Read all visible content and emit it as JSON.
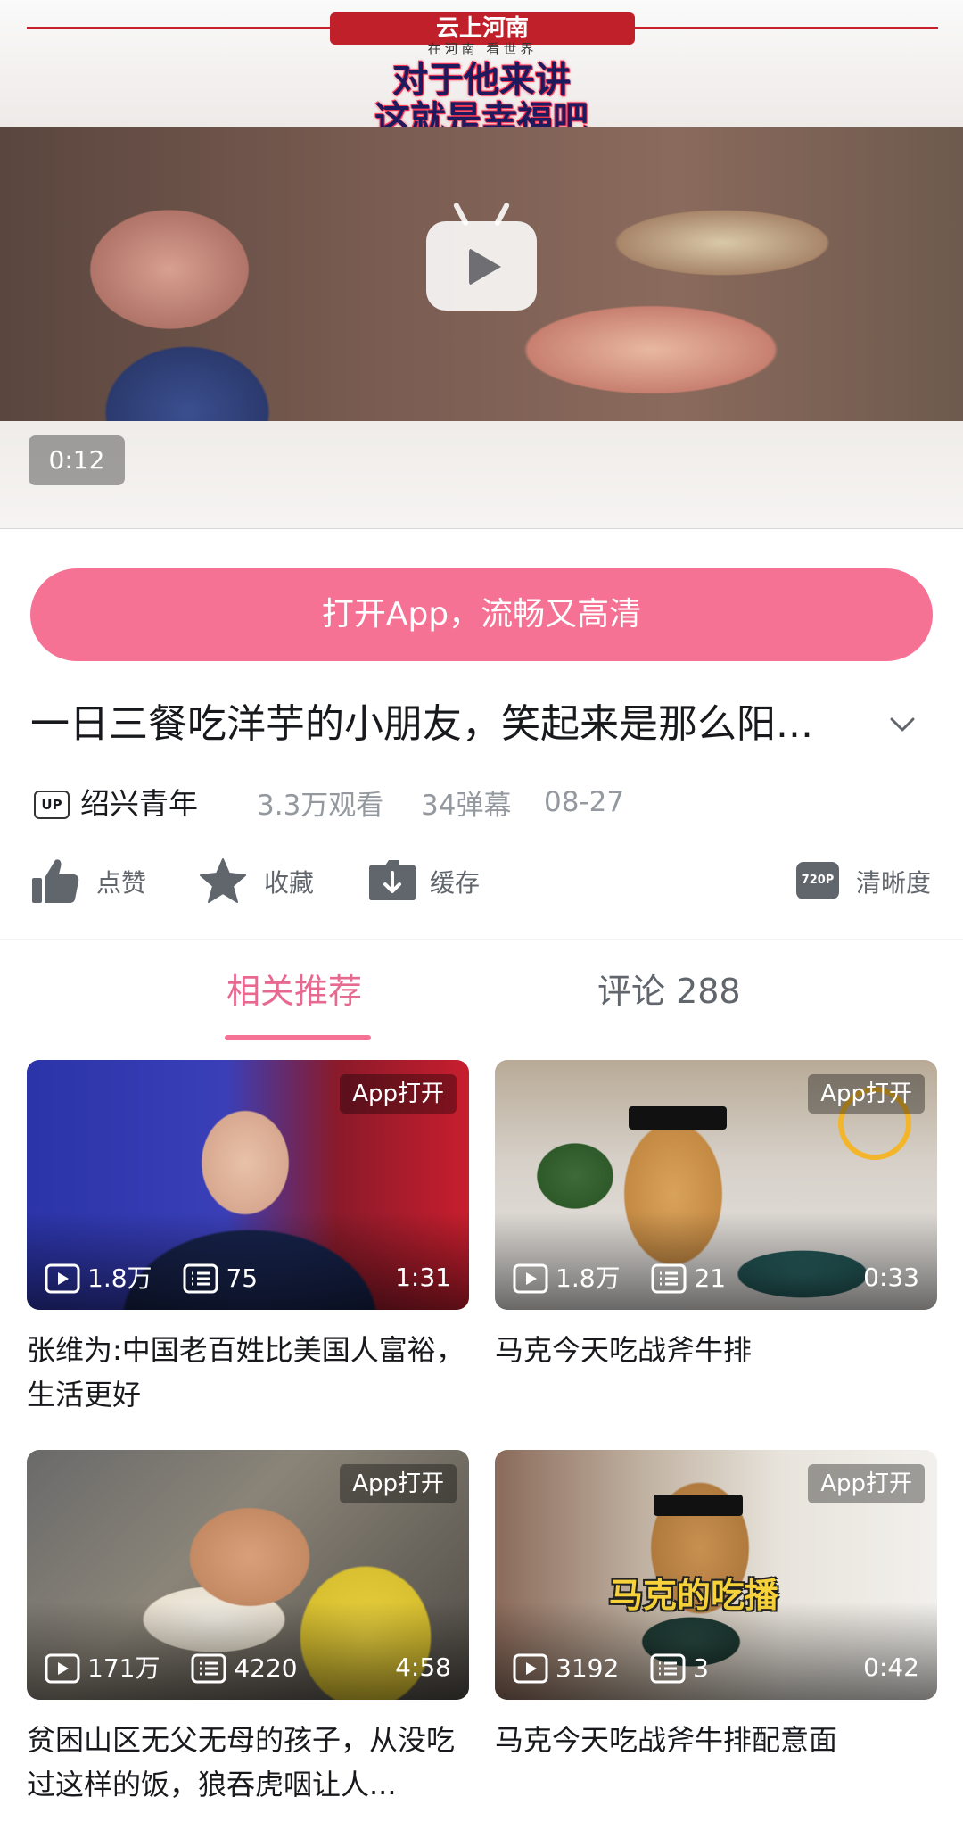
{
  "player": {
    "brand_name": "云上河南",
    "brand_tagline": "在河南  看世界",
    "headline_line1": "对于他来讲",
    "headline_line2": "这就是幸福吧",
    "duration": "0:12"
  },
  "open_app_button": "打开App，流畅又高清",
  "video": {
    "title": "一日三餐吃洋芋的小朋友，笑起来是那么阳...",
    "up_badge": "UP",
    "author": "绍兴青年",
    "views": "3.3万观看",
    "danmaku": "34弹幕",
    "date": "08-27"
  },
  "actions": {
    "like": "点赞",
    "favorite": "收藏",
    "cache": "缓存",
    "quality_badge": "720P",
    "quality": "清晰度"
  },
  "tabs": {
    "related": "相关推荐",
    "comments": "评论 288"
  },
  "cards": [
    {
      "badge": "App打开",
      "plays": "1.8万",
      "danmaku": "75",
      "duration": "1:31",
      "title": "张维为:中国老百姓比美国人富裕，生活更好"
    },
    {
      "badge": "App打开",
      "plays": "1.8万",
      "danmaku": "21",
      "duration": "0:33",
      "title": "马克今天吃战斧牛排"
    },
    {
      "badge": "App打开",
      "plays": "171万",
      "danmaku": "4220",
      "duration": "4:58",
      "title": "贫困山区无父无母的孩子，从没吃过这样的饭，狼吞虎咽让人..."
    },
    {
      "badge": "App打开",
      "plays": "3192",
      "danmaku": "3",
      "duration": "0:42",
      "title": "马克今天吃战斧牛排配意面",
      "overlay_caption": "马克的吃播"
    }
  ],
  "colors": {
    "accent_pink": "#f67295",
    "tab_active": "#e7698f",
    "meta_gray": "#9499a0"
  },
  "icons": [
    "play-icon",
    "chevron-down-icon",
    "thumbs-up-icon",
    "star-icon",
    "download-icon",
    "play-count-icon",
    "danmaku-icon"
  ]
}
